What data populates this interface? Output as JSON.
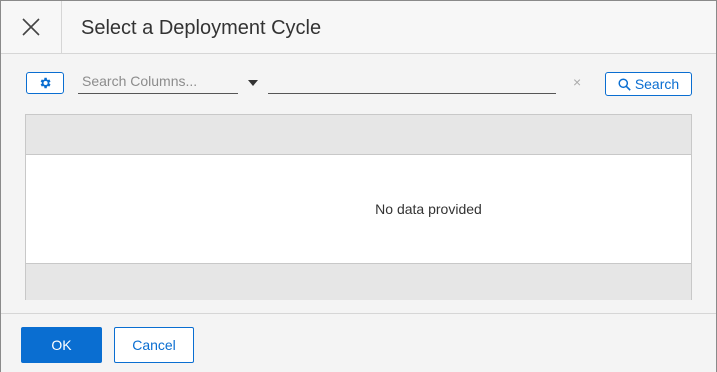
{
  "dialog": {
    "title": "Select a Deployment Cycle",
    "close_icon": "close-icon"
  },
  "toolbar": {
    "settings_icon": "gear-icon",
    "column_placeholder": "Search Columns...",
    "dropdown_icon": "caret-down-icon",
    "search_value": "",
    "clear_label": "×",
    "search_icon": "search-icon",
    "search_label": "Search"
  },
  "table": {
    "columns": [],
    "rows": [],
    "empty_message": "No data provided"
  },
  "footer": {
    "ok_label": "OK",
    "cancel_label": "Cancel"
  },
  "colors": {
    "accent": "#0a6ed1",
    "header_bg": "#f7f7f7",
    "table_bar": "#e6e6e6"
  }
}
